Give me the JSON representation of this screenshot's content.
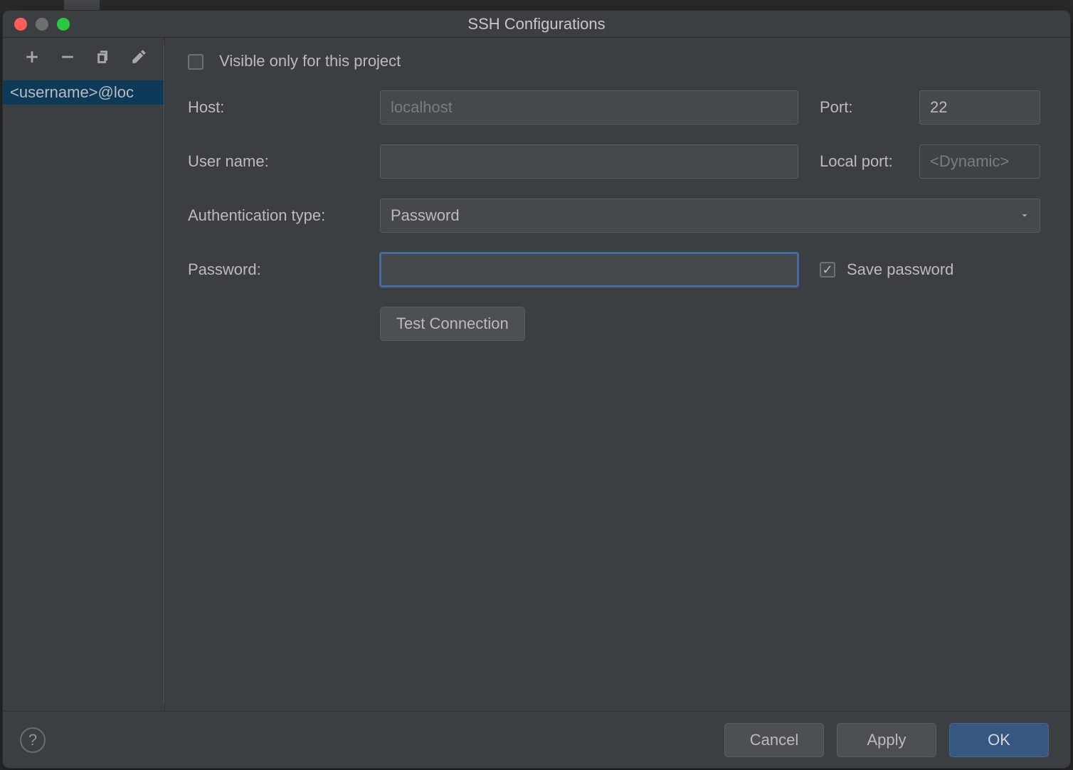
{
  "window": {
    "title": "SSH Configurations"
  },
  "toolbar": {
    "add_tip": "Add",
    "remove_tip": "Remove",
    "copy_tip": "Copy",
    "edit_tip": "Edit"
  },
  "sidebar": {
    "items": [
      {
        "label": "<username>@loc"
      }
    ]
  },
  "form": {
    "visible_only_label": "Visible only for this project",
    "visible_only_checked": false,
    "host_label": "Host:",
    "host_placeholder": "localhost",
    "host_value": "",
    "port_label": "Port:",
    "port_value": "22",
    "user_label": "User name:",
    "user_value": "",
    "localport_label": "Local port:",
    "localport_placeholder": "<Dynamic>",
    "auth_label": "Authentication type:",
    "auth_value": "Password",
    "pw_label": "Password:",
    "pw_value": "",
    "save_pw_label": "Save password",
    "save_pw_checked": true,
    "test_label": "Test Connection"
  },
  "footer": {
    "help": "?",
    "cancel": "Cancel",
    "apply": "Apply",
    "ok": "OK"
  }
}
